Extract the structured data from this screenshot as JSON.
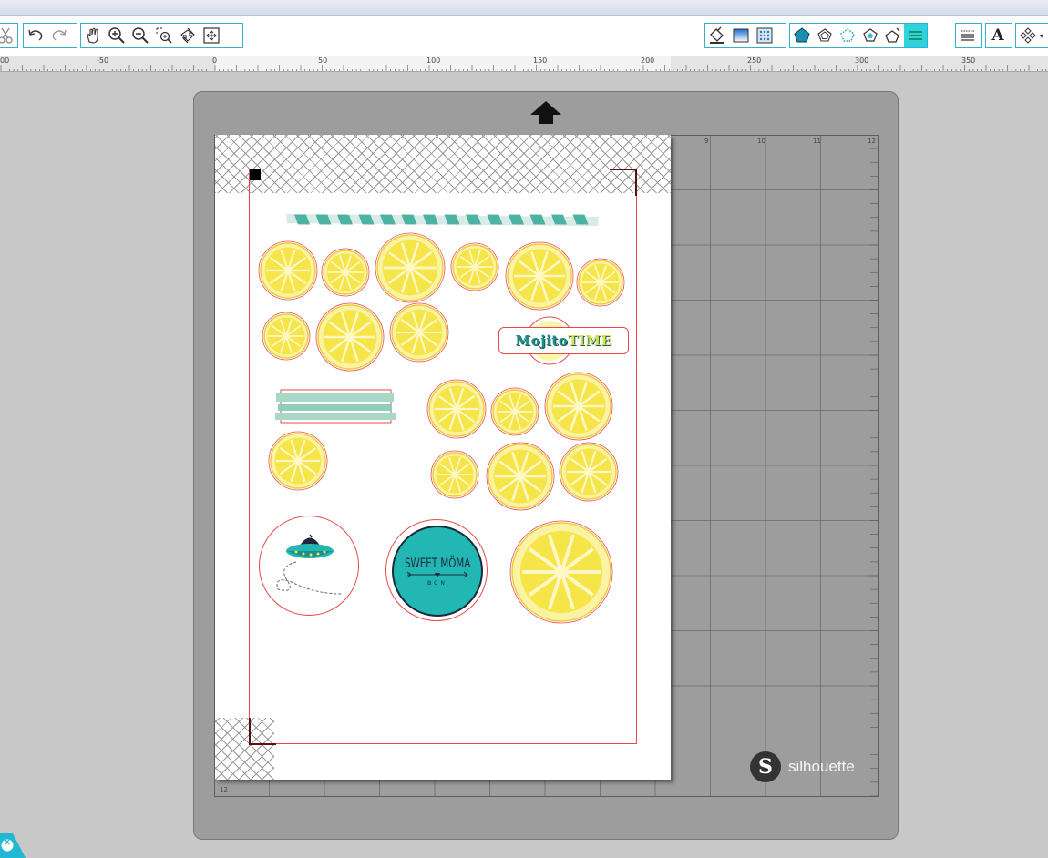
{
  "toolbar": {
    "left_tools": [
      "cut-icon",
      "undo-icon",
      "redo-icon",
      "pan-hand-icon",
      "zoom-in-icon",
      "zoom-out-icon",
      "zoom-selection-icon",
      "zoom-fit-icon",
      "fit-to-page-icon"
    ],
    "right_tools": [
      "fill-color-icon",
      "fill-gradient-icon",
      "fill-pattern-icon",
      "line-color-icon",
      "line-style-icon",
      "line-pattern-icon",
      "shadow-icon",
      "transparency-icon",
      "align-lines-icon",
      "offset-lines-icon",
      "text-style-icon",
      "replicate-icon"
    ],
    "text_tool_label": "A",
    "accent": "#2ed3df",
    "group_border": "#31b4c8"
  },
  "ruler": {
    "labels": [
      "00",
      "-50",
      "0",
      "50",
      "100",
      "150",
      "200",
      "250",
      "300",
      "350"
    ]
  },
  "mat": {
    "grid_columns": [
      "9",
      "10",
      "11",
      "12"
    ],
    "bottom_label": "12",
    "brand": "silhouette",
    "brand_logo": "S"
  },
  "design": {
    "mojito_label_a": "Mojito",
    "mojito_label_b": "TIME",
    "moma_title": "SWEET MÖMA",
    "moma_subtitle": "BCN",
    "cut_line_color": "#e84a4a",
    "lemon_color": "#f4e23a",
    "teal_color": "#22b7b3"
  },
  "side_badge": "x"
}
